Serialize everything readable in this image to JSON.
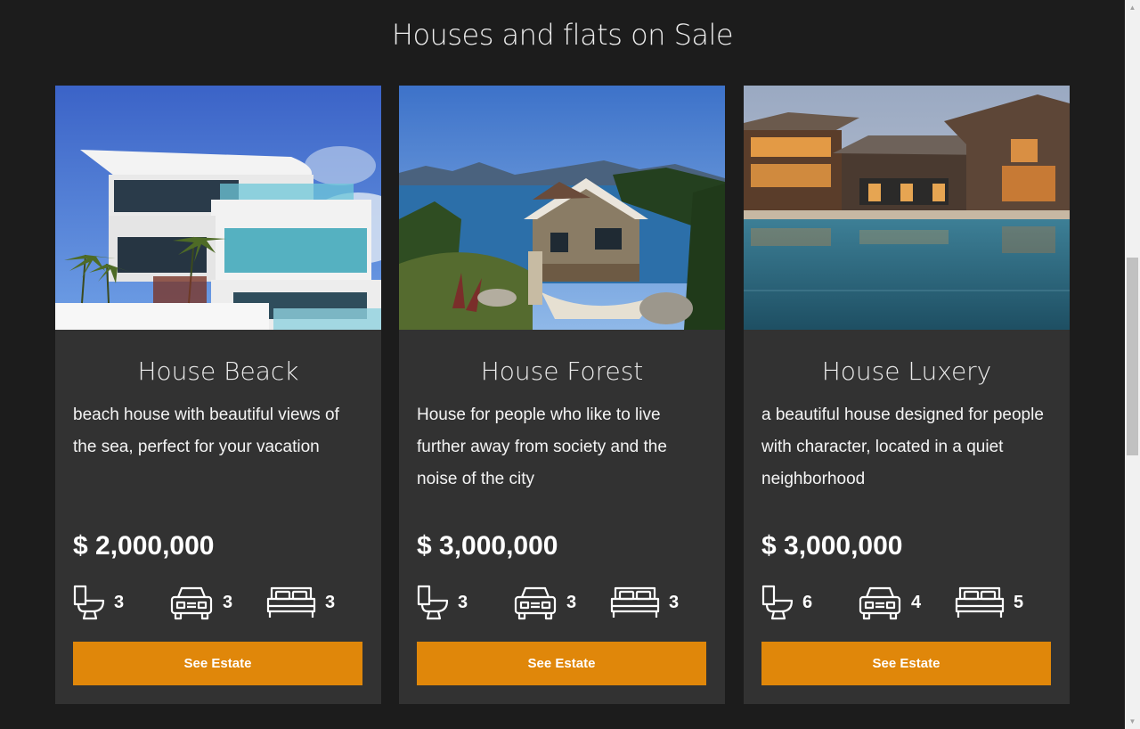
{
  "section": {
    "title": "Houses and flats on Sale"
  },
  "cards": [
    {
      "title": "House Beack",
      "description": "beach house with beautiful views of the sea, perfect for your vacation",
      "price": "$ 2,000,000",
      "bathrooms": "3",
      "garages": "3",
      "bedrooms": "3",
      "button": "See Estate",
      "image": "modern-beach-house-photo"
    },
    {
      "title": "House Forest",
      "description": "House for people who like to live further away from society and the noise of the city",
      "price": "$ 3,000,000",
      "bathrooms": "3",
      "garages": "3",
      "bedrooms": "3",
      "button": "See Estate",
      "image": "lakeside-forest-house-photo"
    },
    {
      "title": "House Luxery",
      "description": "a beautiful house designed for people with character, located in a quiet neighborhood",
      "price": "$ 3,000,000",
      "bathrooms": "6",
      "garages": "4",
      "bedrooms": "5",
      "button": "See Estate",
      "image": "luxury-lodge-with-pool-photo"
    }
  ],
  "icons": {
    "bathroom": "toilet-icon",
    "garage": "car-icon",
    "bedroom": "bed-icon"
  },
  "colors": {
    "background": "#1c1c1c",
    "card": "#323232",
    "accent": "#e0870a",
    "text": "#ffffff"
  }
}
